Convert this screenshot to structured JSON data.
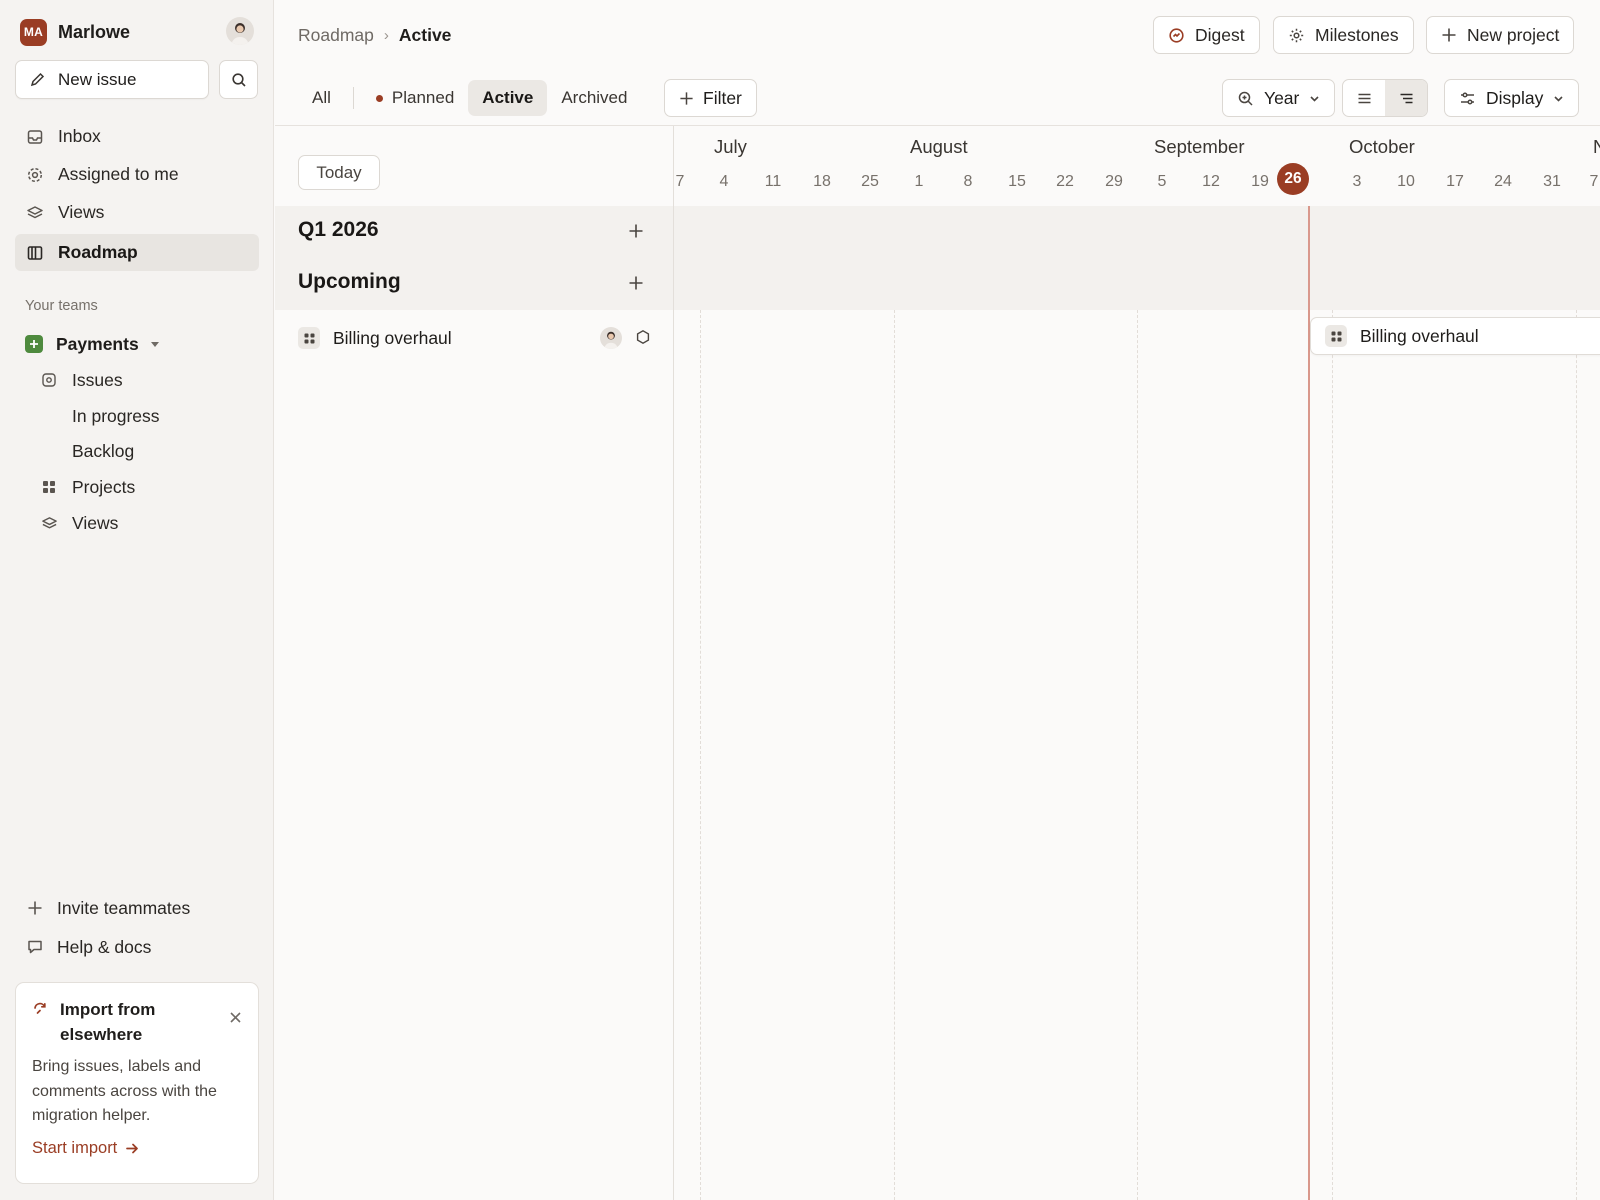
{
  "workspace": {
    "initials": "MA",
    "name": "Marlowe"
  },
  "sidebar": {
    "new_issue_label": "New issue",
    "nav": [
      {
        "label": "Inbox",
        "icon": "inbox-icon"
      },
      {
        "label": "Assigned to me",
        "icon": "target-icon"
      },
      {
        "label": "Views",
        "icon": "layers-icon"
      },
      {
        "label": "Roadmap",
        "icon": "roadmap-icon",
        "active": true
      }
    ],
    "teams_label": "Your teams",
    "team": {
      "name": "Payments",
      "items": [
        {
          "label": "Issues",
          "icon": "issues-icon"
        },
        {
          "label": "In progress"
        },
        {
          "label": "Backlog"
        },
        {
          "label": "Projects",
          "icon": "grid-icon"
        },
        {
          "label": "Views",
          "icon": "layers-icon"
        }
      ]
    },
    "invite_label": "Invite teammates",
    "help_label": "Help & docs",
    "import_card": {
      "title": "Import from elsewhere",
      "body": "Bring issues, labels and comments across with the migration helper.",
      "link": "Start import"
    }
  },
  "header": {
    "breadcrumb_parent": "Roadmap",
    "breadcrumb_sep": "›",
    "breadcrumb_current": "Active",
    "digest_label": "Digest",
    "milestones_label": "Milestones",
    "new_project_label": "New project"
  },
  "tabs": {
    "all": "All",
    "planned": "Planned",
    "active": "Active",
    "archived": "Archived",
    "selected": "Active"
  },
  "toolbar": {
    "filter_label": "Filter",
    "zoom_label": "Year",
    "display_label": "Display"
  },
  "list": {
    "today_label": "Today",
    "groups": [
      {
        "title": "Q1 2026"
      },
      {
        "title": "Upcoming"
      }
    ],
    "project": {
      "name": "Billing overhaul"
    }
  },
  "timeline": {
    "months": [
      "July",
      "August",
      "September",
      "October",
      "N"
    ],
    "days": [
      "7",
      "4",
      "11",
      "18",
      "25",
      "1",
      "8",
      "15",
      "22",
      "29",
      "5",
      "12",
      "19",
      "26",
      "3",
      "10",
      "17",
      "24",
      "31",
      "7"
    ],
    "today_day": "26",
    "bar_label": "Billing overhaul"
  },
  "colors": {
    "accent": "#9a3d24",
    "today_line": "#d9988c",
    "team_badge": "#4e8a3e",
    "active_bg": "#ebe8e4"
  }
}
